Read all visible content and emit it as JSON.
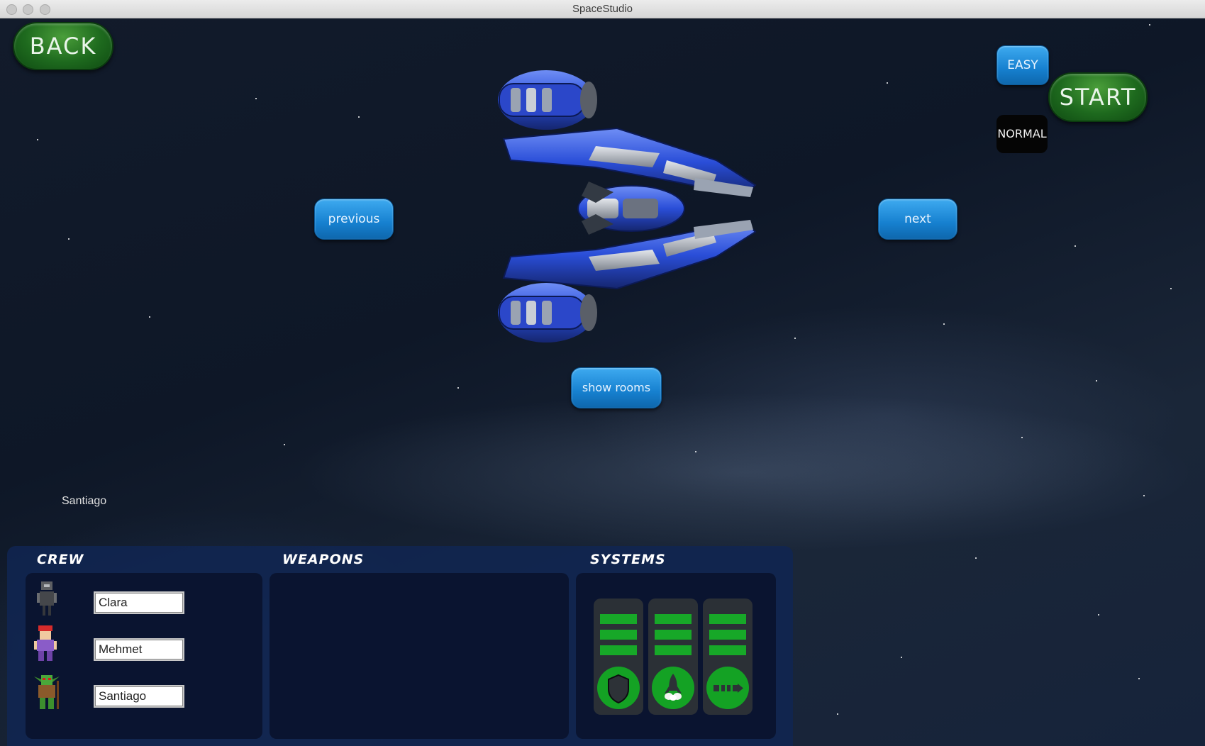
{
  "window": {
    "title": "SpaceStudio"
  },
  "buttons": {
    "back": "BACK",
    "start": "START",
    "easy": "EASY",
    "normal": "NORMAL",
    "previous": "previous",
    "next": "next",
    "show_rooms": "show rooms"
  },
  "overlay_label": "Santiago",
  "panel": {
    "crew": {
      "title": "CREW",
      "members": [
        {
          "name": "Clara",
          "icon": "robot-crew-icon"
        },
        {
          "name": "Mehmet",
          "icon": "human-crew-icon"
        },
        {
          "name": "Santiago",
          "icon": "goblin-crew-icon"
        }
      ]
    },
    "weapons": {
      "title": "WEAPONS"
    },
    "systems": {
      "title": "SYSTEMS",
      "items": [
        {
          "icon": "shield-icon",
          "level": 3
        },
        {
          "icon": "rocket-engine-icon",
          "level": 3
        },
        {
          "icon": "weapon-system-icon",
          "level": 3
        }
      ]
    }
  },
  "colors": {
    "system_bar": "#17a828",
    "accent_blue": "#1680cf",
    "accent_green": "#1e6a1e"
  }
}
